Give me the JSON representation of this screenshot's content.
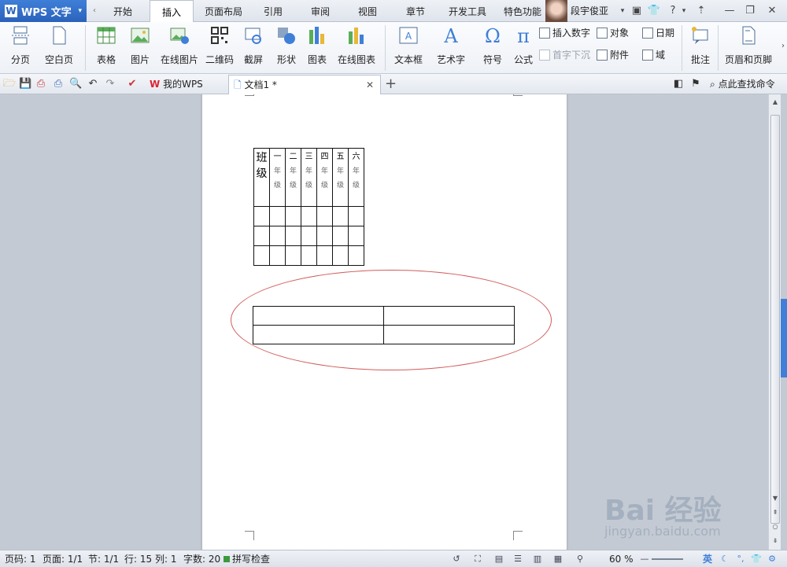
{
  "app": {
    "name": "WPS 文字"
  },
  "menu": {
    "tabs": [
      "开始",
      "插入",
      "页面布局",
      "引用",
      "审阅",
      "视图",
      "章节",
      "开发工具",
      "特色功能"
    ],
    "active_tab": "插入",
    "user_name": "段宇俊亚"
  },
  "ribbon": {
    "buttons": [
      "分页",
      "空白页",
      "表格",
      "图片",
      "在线图片",
      "二维码",
      "截屏",
      "形状",
      "图表",
      "在线图表",
      "文本框",
      "艺术字",
      "符号",
      "公式"
    ],
    "small_buttons": [
      "插入数字",
      "对象",
      "日期",
      "首字下沉",
      "附件",
      "域"
    ],
    "right_buttons": [
      "批注",
      "页眉和页脚"
    ]
  },
  "quickbar": {
    "tabs": [
      "我的WPS",
      "文档1 *"
    ],
    "search_label": "点此查找命令"
  },
  "document": {
    "table1": {
      "first_col": [
        "班",
        "级"
      ],
      "grades": [
        [
          "一",
          "年",
          "级"
        ],
        [
          "二",
          "年",
          "级"
        ],
        [
          "三",
          "年",
          "级"
        ],
        [
          "四",
          "年",
          "级"
        ],
        [
          "五",
          "年",
          "级"
        ],
        [
          "六",
          "年",
          "级"
        ]
      ]
    }
  },
  "status": {
    "page_num": "页码: 1",
    "pages": "页面: 1/1",
    "section": "节: 1/1",
    "row": "行: 15",
    "col": "列: 1",
    "word_count": "字数: 20",
    "spell_check": "拼写检查",
    "zoom": "60 %"
  },
  "watermark": {
    "main": "Bai 经验",
    "sub": "jingyan.baidu.com"
  },
  "colors": {
    "accent": "#2a62bb",
    "ellipse": "#d25b5b"
  }
}
